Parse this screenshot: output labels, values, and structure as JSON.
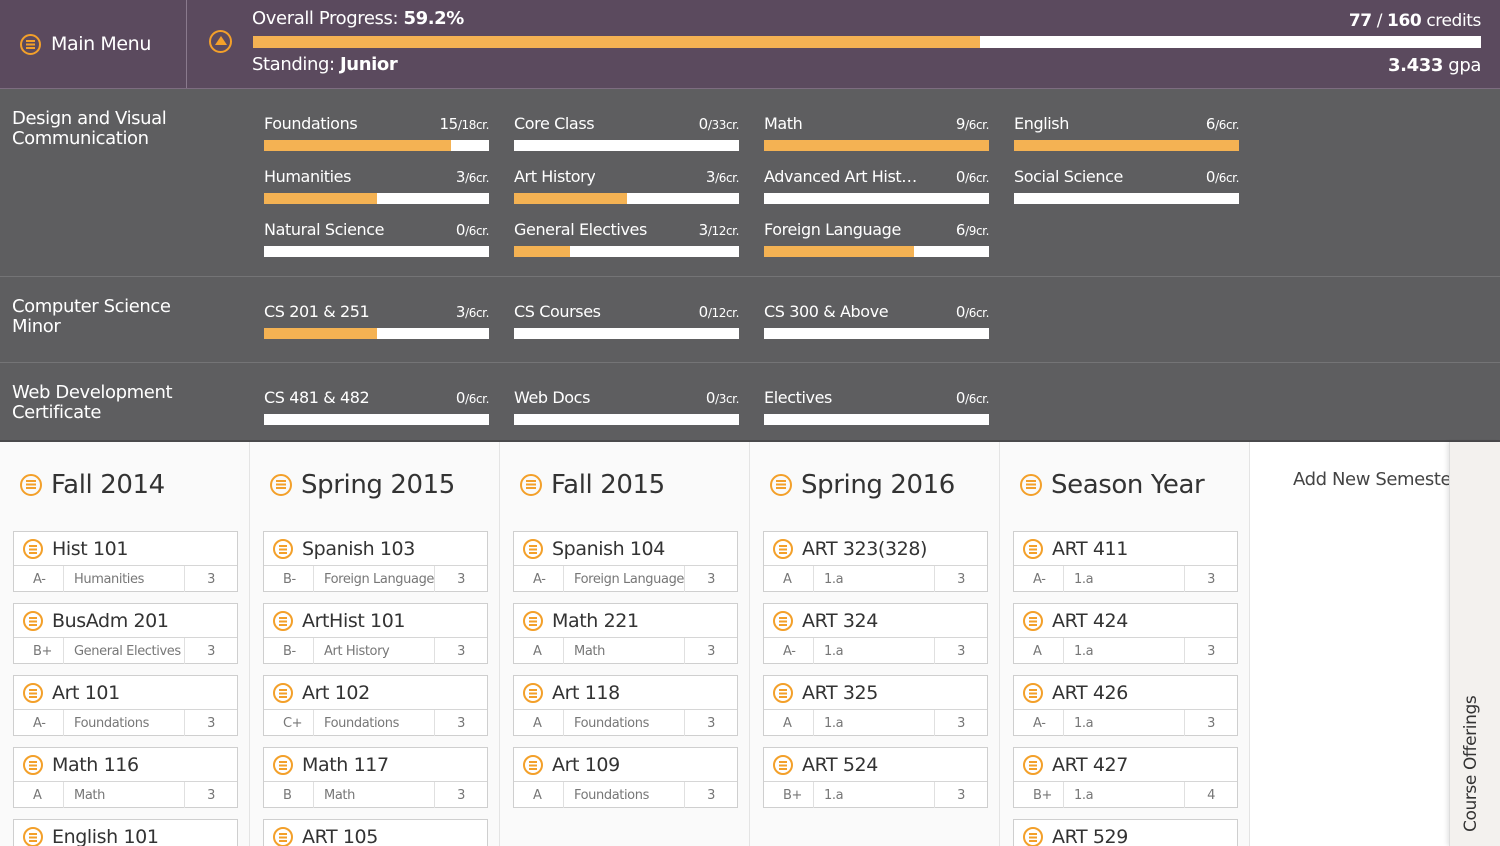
{
  "header": {
    "menu_label": "Main Menu",
    "overall_label": "Overall Progress: ",
    "overall_value": "59.2%",
    "overall_fraction": 0.592,
    "credits_earned": "77",
    "credits_sep": " / ",
    "credits_total": "160",
    "credits_unit": " credits",
    "standing_label": "Standing: ",
    "standing_value": "Junior",
    "gpa_value": "3.433",
    "gpa_unit": " gpa"
  },
  "programs": [
    {
      "name": "Design and Visual Communication",
      "requirements": [
        {
          "name": "Foundations",
          "earned": "15",
          "total": "/18cr.",
          "fraction": 0.833
        },
        {
          "name": "Core Class",
          "earned": "0",
          "total": "/33cr.",
          "fraction": 0
        },
        {
          "name": "Math",
          "earned": "9",
          "total": "/6cr.",
          "fraction": 1
        },
        {
          "name": "English",
          "earned": "6",
          "total": "/6cr.",
          "fraction": 1
        },
        {
          "name": "Humanities",
          "earned": "3",
          "total": "/6cr.",
          "fraction": 0.5
        },
        {
          "name": "Art History",
          "earned": "3",
          "total": "/6cr.",
          "fraction": 0.5
        },
        {
          "name": "Advanced Art History",
          "earned": "0",
          "total": "/6cr.",
          "fraction": 0
        },
        {
          "name": "Social Science",
          "earned": "0",
          "total": "/6cr.",
          "fraction": 0
        },
        {
          "name": "Natural Science",
          "earned": "0",
          "total": "/6cr.",
          "fraction": 0
        },
        {
          "name": "General Electives",
          "earned": "3",
          "total": "/12cr.",
          "fraction": 0.25
        },
        {
          "name": "Foreign Language",
          "earned": "6",
          "total": "/9cr.",
          "fraction": 0.667
        }
      ]
    },
    {
      "name": "Computer Science Minor",
      "requirements": [
        {
          "name": "CS 201 & 251",
          "earned": "3",
          "total": "/6cr.",
          "fraction": 0.5
        },
        {
          "name": "CS Courses",
          "earned": "0",
          "total": "/12cr.",
          "fraction": 0
        },
        {
          "name": "CS 300 & Above",
          "earned": "0",
          "total": "/6cr.",
          "fraction": 0
        }
      ]
    },
    {
      "name": "Web Development Certificate",
      "requirements": [
        {
          "name": "CS 481 & 482",
          "earned": "0",
          "total": "/6cr.",
          "fraction": 0
        },
        {
          "name": "Web Docs",
          "earned": "0",
          "total": "/3cr.",
          "fraction": 0
        },
        {
          "name": "Electives",
          "earned": "0",
          "total": "/6cr.",
          "fraction": 0
        }
      ]
    }
  ],
  "semesters": [
    {
      "title": "Fall 2014",
      "courses": [
        {
          "name": "Hist 101",
          "grade": "A-",
          "category": "Humanities",
          "credits": "3"
        },
        {
          "name": "BusAdm 201",
          "grade": "B+",
          "category": "General Electives",
          "credits": "3"
        },
        {
          "name": "Art 101",
          "grade": "A-",
          "category": "Foundations",
          "credits": "3"
        },
        {
          "name": "Math 116",
          "grade": "A",
          "category": "Math",
          "credits": "3"
        },
        {
          "name": "English 101",
          "grade": "",
          "category": "",
          "credits": ""
        }
      ]
    },
    {
      "title": "Spring 2015",
      "courses": [
        {
          "name": "Spanish 103",
          "grade": "B-",
          "category": "Foreign Language",
          "credits": "3"
        },
        {
          "name": "ArtHist 101",
          "grade": "B-",
          "category": "Art History",
          "credits": "3"
        },
        {
          "name": "Art 102",
          "grade": "C+",
          "category": "Foundations",
          "credits": "3"
        },
        {
          "name": "Math 117",
          "grade": "B",
          "category": "Math",
          "credits": "3"
        },
        {
          "name": "ART 105",
          "grade": "",
          "category": "",
          "credits": ""
        }
      ]
    },
    {
      "title": "Fall 2015",
      "courses": [
        {
          "name": "Spanish 104",
          "grade": "A-",
          "category": "Foreign Language",
          "credits": "3"
        },
        {
          "name": "Math 221",
          "grade": "A",
          "category": "Math",
          "credits": "3"
        },
        {
          "name": "Art 118",
          "grade": "A",
          "category": "Foundations",
          "credits": "3"
        },
        {
          "name": "Art 109",
          "grade": "A",
          "category": "Foundations",
          "credits": "3"
        }
      ]
    },
    {
      "title": "Spring 2016",
      "courses": [
        {
          "name": "ART 323(328)",
          "grade": "A",
          "category": "1.a",
          "credits": "3"
        },
        {
          "name": "ART 324",
          "grade": "A-",
          "category": "1.a",
          "credits": "3"
        },
        {
          "name": "ART 325",
          "grade": "A",
          "category": "1.a",
          "credits": "3"
        },
        {
          "name": "ART 524",
          "grade": "B+",
          "category": "1.a",
          "credits": "3"
        }
      ]
    },
    {
      "title": "Season Year",
      "courses": [
        {
          "name": "ART 411",
          "grade": "A-",
          "category": "1.a",
          "credits": "3"
        },
        {
          "name": "ART 424",
          "grade": "A",
          "category": "1.a",
          "credits": "3"
        },
        {
          "name": "ART 426",
          "grade": "A-",
          "category": "1.a",
          "credits": "3"
        },
        {
          "name": "ART 427",
          "grade": "B+",
          "category": "1.a",
          "credits": "4"
        },
        {
          "name": "ART 529",
          "grade": "",
          "category": "",
          "credits": ""
        }
      ]
    }
  ],
  "add_semester_label": "Add New Semester",
  "drawer_label": "Course Offerings",
  "colors": {
    "accent": "#f3a02a",
    "bar_fill": "#f4b253",
    "header_bg": "#5b4a5e",
    "panel_bg": "#5e5e60"
  }
}
